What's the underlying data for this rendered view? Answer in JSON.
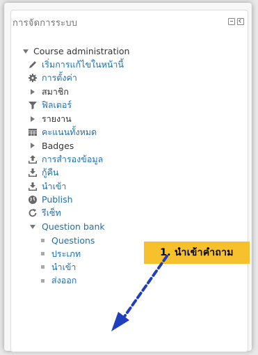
{
  "block": {
    "title": "การจัดการระบบ",
    "minimize_icon": "minus-icon",
    "dock_icon": "dock-icon"
  },
  "tree": [
    {
      "label": "Course administration",
      "icon": "expanded-triangle",
      "level": 0,
      "link": false
    },
    {
      "label": "เริ่มการแก้ไขในหน้านี้",
      "icon": "pencil-icon",
      "level": 1,
      "link": true
    },
    {
      "label": "การตั้งค่า",
      "icon": "gear-icon",
      "level": 1,
      "link": true
    },
    {
      "label": "สมาชิก",
      "icon": "collapsed-triangle",
      "level": 1,
      "link": false
    },
    {
      "label": "ฟิลเตอร์",
      "icon": "filter-icon",
      "level": 1,
      "link": true
    },
    {
      "label": "รายงาน",
      "icon": "collapsed-triangle",
      "level": 1,
      "link": false
    },
    {
      "label": "คะแนนทั้งหมด",
      "icon": "table-icon",
      "level": 1,
      "link": true
    },
    {
      "label": "Badges",
      "icon": "collapsed-triangle",
      "level": 1,
      "link": false
    },
    {
      "label": "การสำรองข้อมูล",
      "icon": "upload-icon",
      "level": 1,
      "link": true
    },
    {
      "label": "กู้คืน",
      "icon": "download-icon",
      "level": 1,
      "link": true
    },
    {
      "label": "นำเข้า",
      "icon": "download-icon",
      "level": 1,
      "link": true
    },
    {
      "label": "Publish",
      "icon": "globe-icon",
      "level": 1,
      "link": true
    },
    {
      "label": "รีเซ็ท",
      "icon": "refresh-icon",
      "level": 1,
      "link": true
    },
    {
      "label": "Question bank",
      "icon": "expanded-triangle",
      "level": 1,
      "link": true
    },
    {
      "label": "Questions",
      "icon": "bullet-icon",
      "level": 2,
      "link": true
    },
    {
      "label": "ประเภท",
      "icon": "bullet-icon",
      "level": 2,
      "link": true
    },
    {
      "label": "นำเข้า",
      "icon": "bullet-icon",
      "level": 2,
      "link": true
    },
    {
      "label": "ส่งออก",
      "icon": "bullet-icon",
      "level": 2,
      "link": true
    }
  ],
  "callout": {
    "text": "1. นำเข้าคำถาม",
    "color": "#f6c12d"
  },
  "colors": {
    "link": "#1f6fae",
    "arrow": "#1f3fbf"
  }
}
